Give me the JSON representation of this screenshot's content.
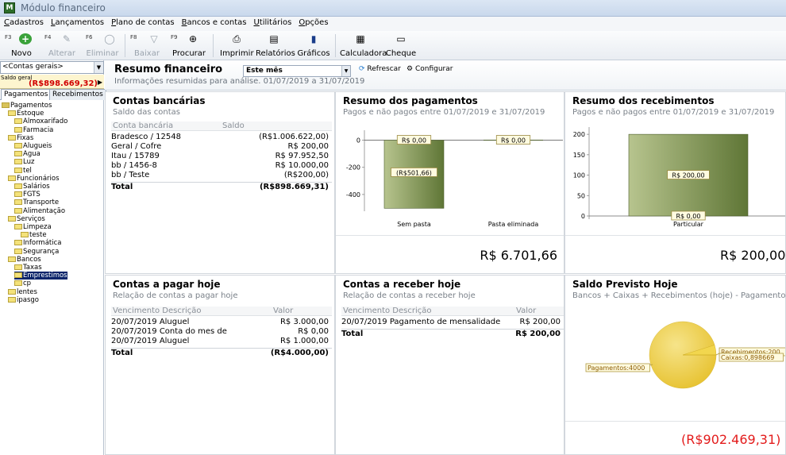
{
  "window": {
    "title": "Módulo financeiro"
  },
  "menu": [
    "Cadastros",
    "Lançamentos",
    "Plano de contas",
    "Bancos e contas",
    "Utilitários",
    "Opções"
  ],
  "toolbar": [
    {
      "key": "F3",
      "label": "Novo",
      "icon": "add-icon",
      "enabled": true
    },
    {
      "key": "F4",
      "label": "Alterar",
      "icon": "pencil-icon",
      "enabled": false
    },
    {
      "key": "F6",
      "label": "Eliminar",
      "icon": "delete-icon",
      "enabled": false
    },
    {
      "key": "F8",
      "label": "Baixar",
      "icon": "filter-icon",
      "enabled": false
    },
    {
      "key": "F9",
      "label": "Procurar",
      "icon": "binoculars-icon",
      "enabled": true
    },
    {
      "key": "",
      "label": "Imprimir",
      "icon": "printer-icon",
      "enabled": true
    },
    {
      "key": "",
      "label": "Relatórios",
      "icon": "report-icon",
      "enabled": true
    },
    {
      "key": "",
      "label": "Gráficos",
      "icon": "bar-chart-icon",
      "enabled": true
    },
    {
      "key": "",
      "label": "Calculadora",
      "icon": "calculator-icon",
      "enabled": true
    },
    {
      "key": "",
      "label": "Cheque",
      "icon": "cheque-icon",
      "enabled": true
    }
  ],
  "left": {
    "account_select": "<Contas gerais>",
    "saldo_label": "Saldo geral",
    "saldo_value": "(R$898.669,32)",
    "tabs": [
      "Pagamentos",
      "Recebimentos"
    ],
    "tree": [
      {
        "label": "Pagamentos",
        "level": 0
      },
      {
        "label": "Estoque",
        "level": 1
      },
      {
        "label": "Almoxarifado",
        "level": 2
      },
      {
        "label": "Farmacia",
        "level": 2
      },
      {
        "label": "Fixas",
        "level": 1
      },
      {
        "label": "Alugueis",
        "level": 2
      },
      {
        "label": "Agua",
        "level": 2
      },
      {
        "label": "Luz",
        "level": 2
      },
      {
        "label": "tel",
        "level": 2
      },
      {
        "label": "Funcionários",
        "level": 1
      },
      {
        "label": "Salários",
        "level": 2
      },
      {
        "label": "FGTS",
        "level": 2
      },
      {
        "label": "Transporte",
        "level": 2
      },
      {
        "label": "Alimentação",
        "level": 2
      },
      {
        "label": "Serviços",
        "level": 1
      },
      {
        "label": "Limpeza",
        "level": 2
      },
      {
        "label": "teste",
        "level": 3
      },
      {
        "label": "Informática",
        "level": 2
      },
      {
        "label": "Segurança",
        "level": 2
      },
      {
        "label": "Bancos",
        "level": 1
      },
      {
        "label": "Taxas",
        "level": 2
      },
      {
        "label": "Emprestimos",
        "level": 2,
        "selected": true
      },
      {
        "label": "cp",
        "level": 2
      },
      {
        "label": "lentes",
        "level": 1
      },
      {
        "label": "ipasgo",
        "level": 1
      }
    ]
  },
  "header": {
    "title": "Resumo financeiro",
    "subtitle": "Informações resumidas para análise.",
    "period_range": "01/07/2019 a 31/07/2019",
    "period_select": "Este mês",
    "refresh": "Refrescar",
    "config": "Configurar"
  },
  "contas_bancarias": {
    "title": "Contas bancárias",
    "subtitle": "Saldo das contas",
    "col1": "Conta bancária",
    "col2": "Saldo",
    "rows": [
      {
        "name": "Bradesco / 12548",
        "value": "(R$1.006.622,00)"
      },
      {
        "name": "Geral / Cofre",
        "value": "R$ 200,00"
      },
      {
        "name": "Itau / 15789",
        "value": "R$ 97.952,50"
      },
      {
        "name": "bb / 1456-8",
        "value": "R$ 10.000,00"
      },
      {
        "name": "bb / Teste",
        "value": "(R$200,00)"
      }
    ],
    "total_label": "Total",
    "total_value": "(R$898.669,31)"
  },
  "resumo_pagamentos": {
    "title": "Resumo dos pagamentos",
    "subtitle": "Pagos e não pagos entre 01/07/2019 e 31/07/2019",
    "total": "R$ 6.701,66"
  },
  "resumo_recebimentos": {
    "title": "Resumo dos recebimentos",
    "subtitle": "Pagos e não pagos entre 01/07/2019 e 31/07/2019",
    "total": "R$ 200,00"
  },
  "contas_pagar": {
    "title": "Contas a pagar hoje",
    "subtitle": "Relação de contas a pagar hoje",
    "col1": "Vencimento Descrição",
    "col2": "Valor",
    "rows": [
      {
        "name": "20/07/2019 Aluguel",
        "value": "R$ 3.000,00"
      },
      {
        "name": "20/07/2019 Conta do mes de",
        "value": "R$ 0,00"
      },
      {
        "name": "20/07/2019 Aluguel",
        "value": "R$ 1.000,00"
      }
    ],
    "total_label": "Total",
    "total_value": "(R$4.000,00)"
  },
  "contas_receber": {
    "title": "Contas a receber hoje",
    "subtitle": "Relação de contas a receber hoje",
    "col1": "Vencimento Descrição",
    "col2": "Valor",
    "rows": [
      {
        "name": "20/07/2019 Pagamento de mensalidade",
        "value": "R$ 200,00"
      }
    ],
    "total_label": "Total",
    "total_value": "R$ 200,00"
  },
  "saldo_previsto": {
    "title": "Saldo Previsto Hoje",
    "subtitle": "Bancos + Caixas + Recebimentos (hoje) - Pagamentos (Hoje)",
    "total": "(R$902.469,31)"
  },
  "chart_data": [
    {
      "type": "bar",
      "name": "pagamentos",
      "categories": [
        "Sem pasta",
        "Pasta eliminada"
      ],
      "values": [
        -501.66,
        0
      ],
      "data_labels": [
        "(R$501,66)",
        "R$ 0,00"
      ],
      "zero_labels": [
        "R$ 0,00",
        "R$ 0,00"
      ],
      "ylim": [
        -500,
        50
      ],
      "yticks": [
        0,
        -200,
        -400
      ],
      "colors": {
        "bar_top": "#b7c48e",
        "bar_bottom": "#5f7636"
      }
    },
    {
      "type": "bar",
      "name": "recebimentos",
      "categories": [
        "Particular"
      ],
      "values": [
        200
      ],
      "data_labels": [
        "R$ 200,00"
      ],
      "zero_labels": [
        "R$ 0,00"
      ],
      "ylim": [
        0,
        210
      ],
      "yticks": [
        200,
        150,
        100,
        50,
        0
      ],
      "colors": {
        "bar_top": "#b7c48e",
        "bar_bottom": "#5f7636"
      }
    },
    {
      "type": "pie",
      "name": "saldo",
      "slices": [
        {
          "label": "Pagamentos:4000",
          "value": 4000,
          "color": "#e7c230"
        },
        {
          "label": "Recebimentos:200",
          "value": 200,
          "color": "#f2d64e"
        },
        {
          "label": "Caixas:0,898669",
          "value": 0.898669,
          "color": "#f5e08a"
        }
      ]
    }
  ]
}
